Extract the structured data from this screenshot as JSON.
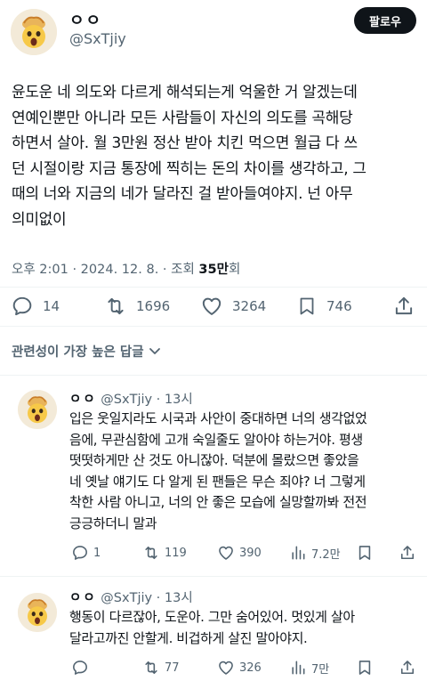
{
  "main_tweet": {
    "author_name": "ㅇㅇ",
    "author_handle": "@SxTjiy",
    "follow_label": "팔로우",
    "lines": [
      "윤도운 네 의도와 다르게 해석되는게 억울한 거 알겠는데",
      "연예인뿐만 아니라 모든 사람들이 자신의 의도를 곡해당",
      "하면서 살아. 월 3만원 정산 받아 치킨 먹으면 월급 다 쓰",
      "던 시절이랑 지금 통장에 찍히는 돈의 차이를 생각하고, 그",
      "때의 너와 지금의 네가 달라진 걸 받아들여야지. 넌 아무",
      "의미없이"
    ],
    "timestamp": "오후 2:01 · 2024. 12. 8. · 조회 ",
    "views": "35만",
    "views_suffix": "회",
    "stats": {
      "replies": "14",
      "retweets": "1696",
      "likes": "3264",
      "bookmarks": "746"
    }
  },
  "reply_sort_label": "관련성이 가장 높은 답글",
  "replies": [
    {
      "author_name": "ㅇㅇ",
      "author_handle": "@SxTjiy",
      "sep": " · ",
      "time": "13시",
      "lines": [
        "입은 웃일지라도 시국과 사안이 중대하면 너의 생각없었",
        "음에, 무관심함에 고개 숙일줄도 알아야 하는거야. 평생",
        "떳떳하게만 산 것도 아니잖아. 덕분에 몰랐으면 좋았을",
        "네 옛날 얘기도 다 알게 된 팬들은 무슨 죄야? 너 그렇게",
        "착한 사람 아니고, 너의 안 좋은 모습에 실망할까봐 전전",
        "긍긍하더니 말과"
      ],
      "stats": {
        "replies": "1",
        "retweets": "119",
        "likes": "390",
        "views": "7.2만"
      }
    },
    {
      "author_name": "ㅇㅇ",
      "author_handle": "@SxTjiy",
      "sep": " · ",
      "time": "13시",
      "lines": [
        "행동이 다르잖아, 도운아. 그만 숨어있어. 멋있게 살아",
        "달라고까진 안할게. 비겁하게 살진 말아야지."
      ],
      "stats": {
        "retweets": "77",
        "likes": "326",
        "views": "7만"
      }
    }
  ],
  "colors": {
    "text": "#0f1419",
    "secondary": "#536471",
    "divider": "#eff3f4",
    "follow_bg": "#0f1419"
  },
  "icons": [
    "reply-icon",
    "retweet-icon",
    "like-icon",
    "bookmark-icon",
    "share-icon",
    "views-icon",
    "chevron-down-icon",
    "avatar-emoji-shocked"
  ]
}
